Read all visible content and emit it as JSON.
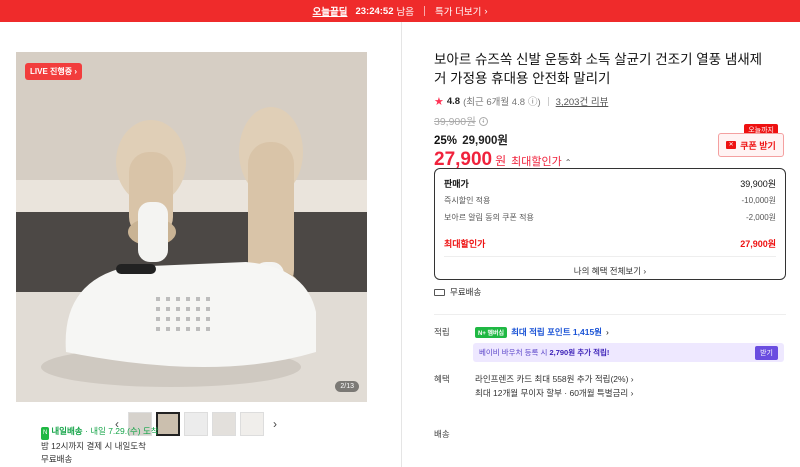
{
  "topbar": {
    "brand": "오늘끝딜",
    "timer": "23:24:52",
    "timer_suffix": "남음",
    "more": "특가 더보기"
  },
  "gallery": {
    "live_badge": "LIVE 진행중",
    "counter": "2/13",
    "thumb_count": 5,
    "active_thumb": 1
  },
  "product": {
    "title": "보아르 슈즈쏙 신발 운동화 소독 살균기 건조기 열풍 냄새제거 가정용 휴대용 안전화 말리기",
    "rating": "4.8",
    "rating_sub": "(최근 6개월 4.8",
    "reviews": "3,203건 리뷰",
    "original_price": "39,900원",
    "sale_pct": "25%",
    "sale_price": "29,900원",
    "final_price": "27,900",
    "final_unit": "원",
    "final_label": "최대할인가"
  },
  "coupon": {
    "tag": "오늘까지",
    "label": "쿠폰 받기"
  },
  "breakdown": {
    "rows": [
      {
        "label": "판매가",
        "value": "39,900원"
      },
      {
        "label": "즉시할인 적용",
        "value": "-10,000원"
      },
      {
        "label": "보아르 알림 동의 쿠폰 적용",
        "value": "-2,000원"
      }
    ],
    "max_label": "최대할인가",
    "max_value": "27,900원",
    "all_benefits": "나의 혜택 전체보기"
  },
  "shipping_free": "무료배송",
  "points": {
    "label": "적립",
    "badge": "N+ 멤버십",
    "text": "최대 적립 포인트 1,415원",
    "voucher_text_a": "베이비 바우처 등록 시 ",
    "voucher_text_b": "2,790원 추가 적립!",
    "voucher_btn": "받기"
  },
  "benefits": {
    "label": "혜택",
    "line1": "라인프렌즈 카드 최대 558원 추가 적립(2%)",
    "line2": "최대 12개월 무이자 할부 · 60개월 특별금리"
  },
  "delivery": {
    "label": "배송",
    "badge": "N",
    "fast": "내일배송",
    "date": "· 내일 7.29.(수) 도착",
    "line2": "밤 12시까지 결제 시 내일도착",
    "line3": "무료배송"
  }
}
